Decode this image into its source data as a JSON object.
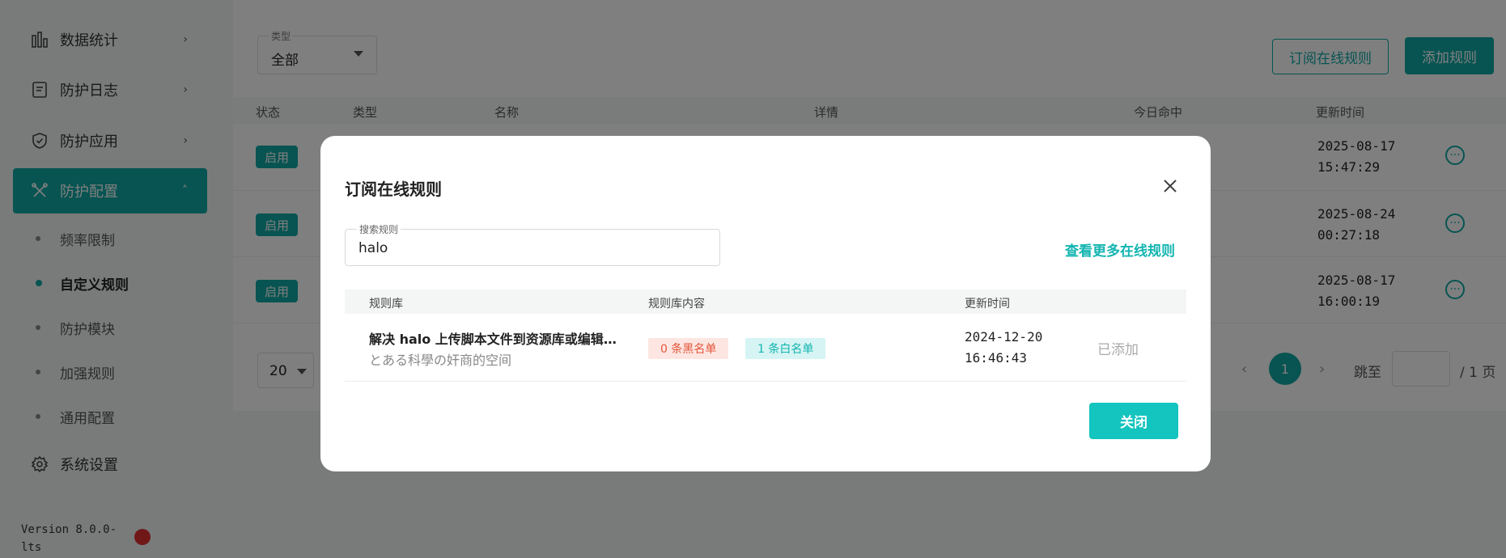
{
  "sidebar": {
    "items": [
      {
        "label": "数据统计",
        "icon": "bar-chart-icon"
      },
      {
        "label": "防护日志",
        "icon": "log-icon"
      },
      {
        "label": "防护应用",
        "icon": "shield-icon"
      },
      {
        "label": "防护配置",
        "icon": "tools-icon"
      },
      {
        "label": "系统设置",
        "icon": "gear-icon"
      }
    ],
    "sub_items": [
      "频率限制",
      "自定义规则",
      "防护模块",
      "加强规则",
      "通用配置"
    ],
    "version": "Version 8.0.0-lts"
  },
  "toolbar": {
    "type_label": "类型",
    "type_value": "全部",
    "subscribe_label": "订阅在线规则",
    "add_label": "添加规则"
  },
  "table": {
    "headers": [
      "状态",
      "类型",
      "名称",
      "详情",
      "今日命中",
      "更新时间"
    ],
    "rows": [
      {
        "status": "启用",
        "time_date": "2025-08-17",
        "time_clock": "15:47:29"
      },
      {
        "status": "启用",
        "time_date": "2025-08-24",
        "time_clock": "00:27:18"
      },
      {
        "status": "启用",
        "time_date": "2025-08-17",
        "time_clock": "16:00:19"
      }
    ]
  },
  "pagination": {
    "page_size": "20",
    "current": "1",
    "jump_label": "跳至",
    "total_label": "/ 1 页"
  },
  "dialog": {
    "title": "订阅在线规则",
    "search_label": "搜索规则",
    "search_value": "halo",
    "more_link": "查看更多在线规则",
    "headers": [
      "规则库",
      "规则库内容",
      "更新时间"
    ],
    "rows": [
      {
        "name": "解决 halo 上传脚本文件到资源库或编辑文章时误拦截的问题",
        "author": "とある科學の奸商的空间",
        "black_tag": "0 条黑名单",
        "white_tag": "1 条白名单",
        "time_date": "2024-12-20",
        "time_clock": "16:46:43",
        "status": "已添加"
      }
    ],
    "close_label": "关闭"
  },
  "colors": {
    "primary": "#0fa8a5",
    "accent": "#13c4bf",
    "danger": "#e4553a"
  }
}
